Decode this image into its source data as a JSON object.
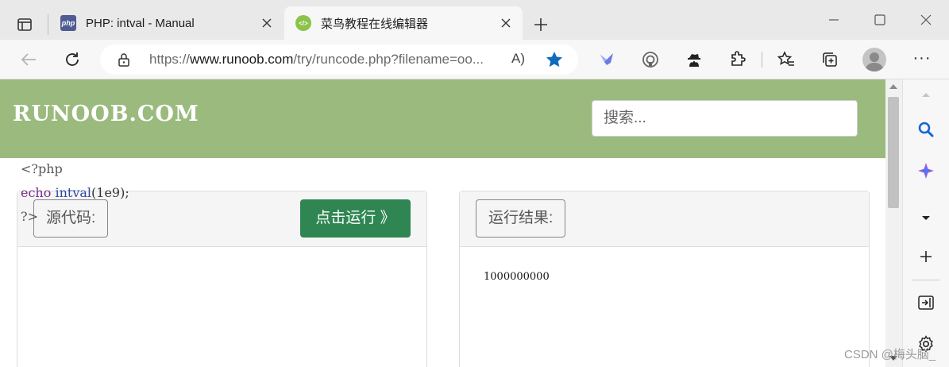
{
  "browser": {
    "tabs": [
      {
        "title": "PHP: intval - Manual",
        "favicon_text": "php",
        "active": false
      },
      {
        "title": "菜鸟教程在线编辑器",
        "favicon_text": "</>",
        "active": true
      }
    ],
    "url_prefix": "https://",
    "url_host": "www.runoob.com",
    "url_path": "/try/runcode.php?filename=oo...",
    "read_aloud": "A)",
    "accent_color": "#0f6cbd"
  },
  "site": {
    "logo": "RUNOOB.COM",
    "search_placeholder": "搜索...",
    "header_color": "#9bba7e"
  },
  "editor": {
    "source_label": "源代码:",
    "run_button": "点击运行 》",
    "code_line1": "<?php",
    "code_kw": "echo",
    "code_fn": "intval",
    "code_args": "(1e9);",
    "code_line3": "?>"
  },
  "result": {
    "label": "运行结果:",
    "output": "1000000000"
  },
  "watermark": "CSDN @梅头脑_"
}
